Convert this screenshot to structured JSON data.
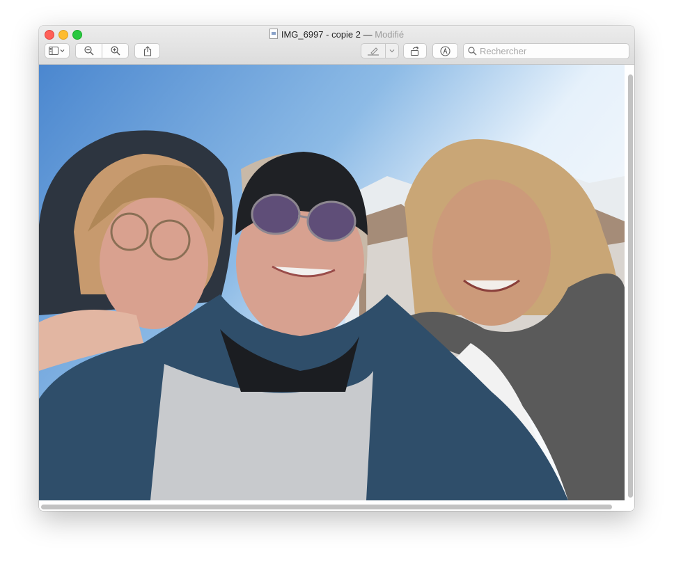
{
  "window": {
    "filename": "IMG_6997 - copie 2",
    "separator": " — ",
    "status": "Modifié"
  },
  "toolbar": {
    "sidebar_icon": "sidebar-icon",
    "zoom_out_icon": "zoom-out-icon",
    "zoom_in_icon": "zoom-in-icon",
    "share_icon": "share-icon",
    "markup_icon": "highlighter-icon",
    "rotate_icon": "rotate-icon",
    "annotate_icon": "markup-pen-icon",
    "search_placeholder": "Rechercher"
  },
  "photo": {
    "description_icon": "photo-image",
    "subjects": [
      "woman-hood-glasses",
      "woman-beanie-sunglasses",
      "woman-houndstooth-scarf"
    ]
  },
  "colors": {
    "close": "#ff5f57",
    "minimize": "#febc2e",
    "maximize": "#28c840",
    "sky": "#4f8ad0"
  }
}
